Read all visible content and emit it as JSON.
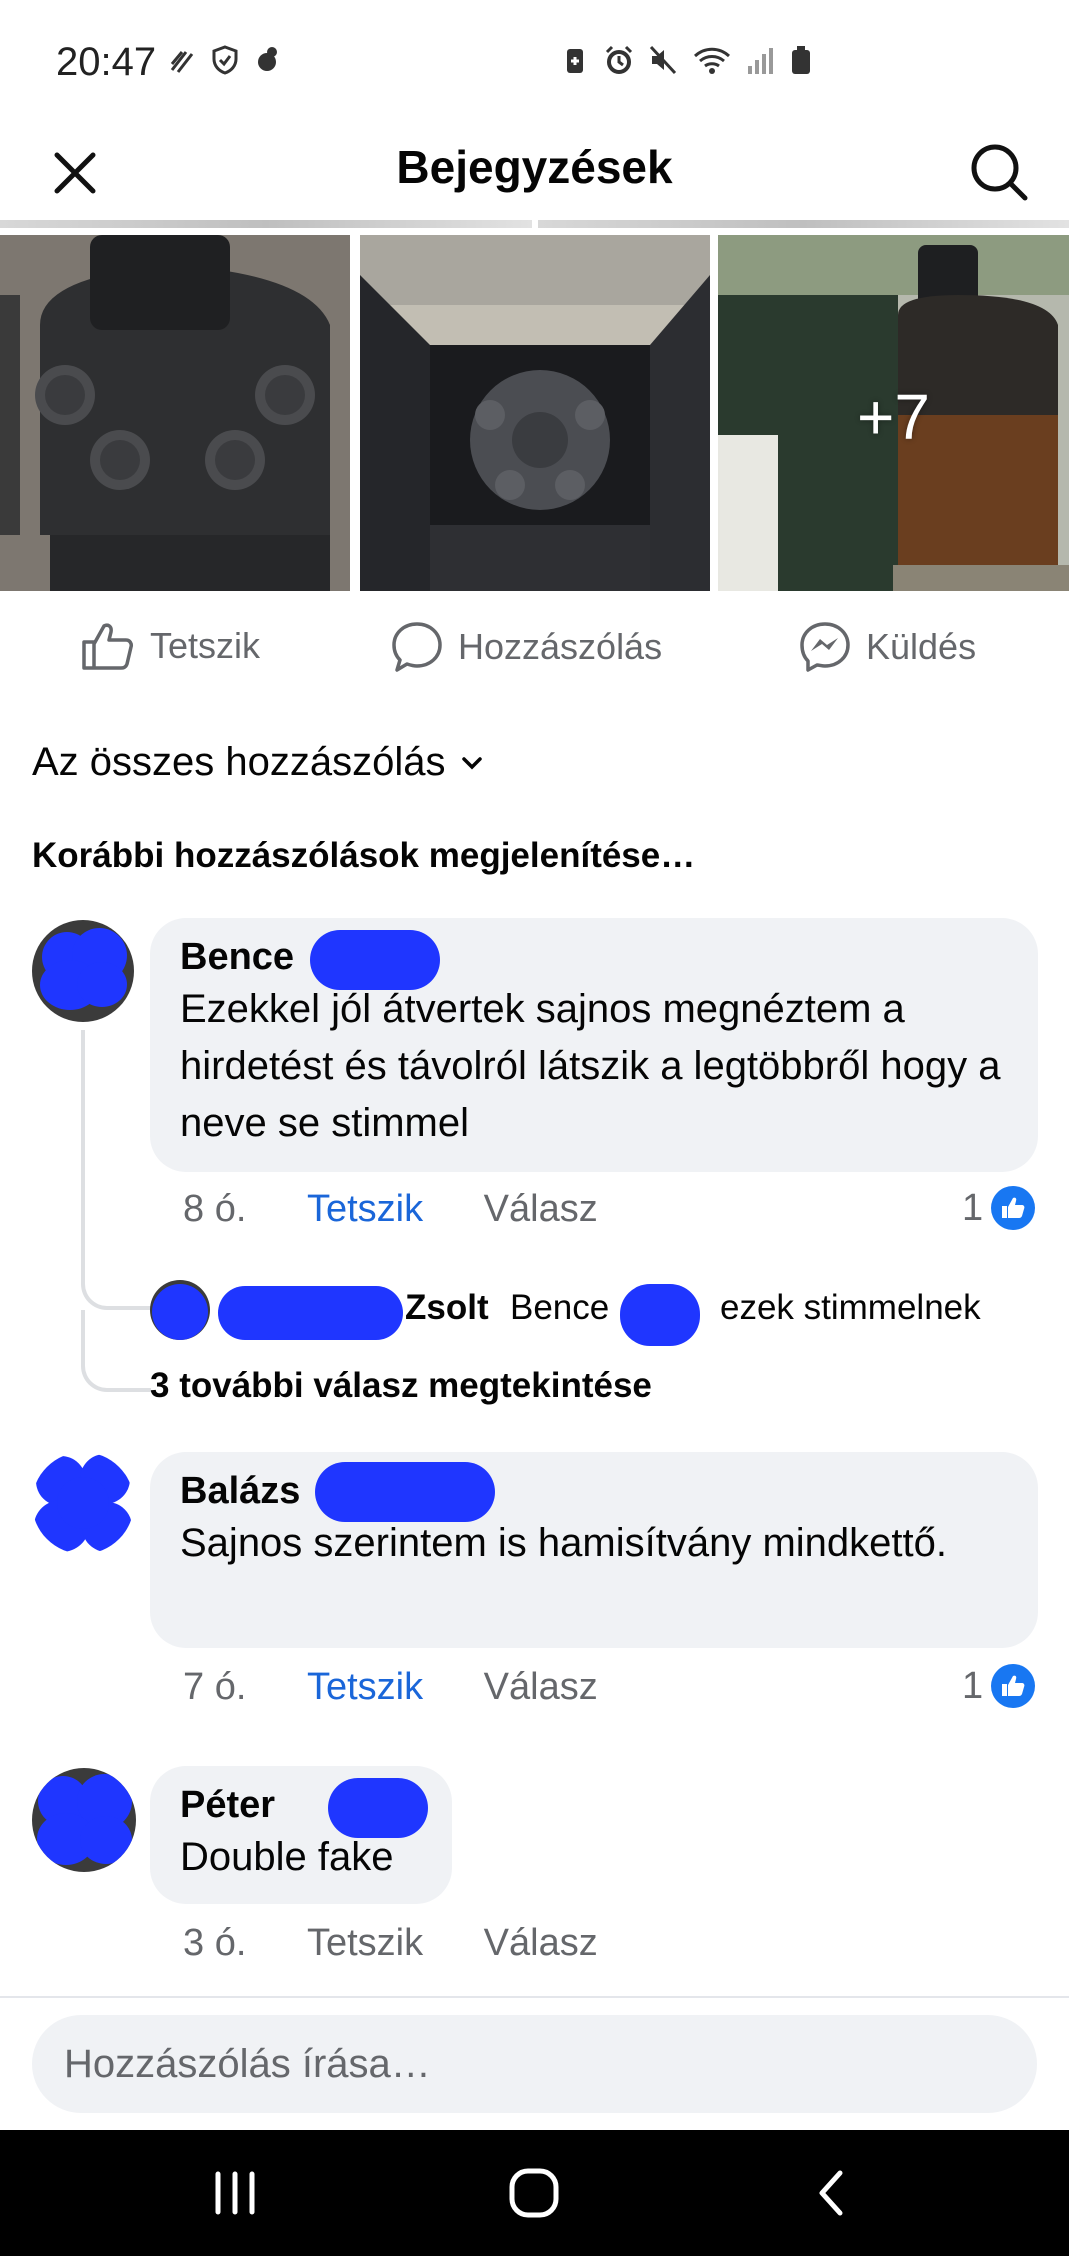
{
  "status_bar": {
    "time": "20:47",
    "left_icons": [
      "no-sim-stripes-icon",
      "shield-icon",
      "notification-icon"
    ],
    "right_icons": [
      "battery-saver-icon",
      "alarm-icon",
      "mute-icon",
      "wifi-icon",
      "signal-icon",
      "battery-icon"
    ]
  },
  "header": {
    "title": "Bejegyzések",
    "close_icon": "close-icon",
    "search_icon": "search-icon"
  },
  "photos": {
    "more_count": "+7"
  },
  "actions": {
    "like": "Tetszik",
    "comment": "Hozzászólás",
    "send": "Küldés"
  },
  "filter": {
    "label": "Az összes hozzászólás"
  },
  "previous_comments": "Korábbi hozzászólások megjelenítése…",
  "comments": [
    {
      "author": "Bence",
      "text": "Ezekkel jól átvertek sajnos megnéztem a hirdetést és távolról látszik a legtöbbről hogy a neve se stimmel",
      "time": "8 ó.",
      "like": "Tetszik",
      "reply": "Válasz",
      "reactions": "1"
    },
    {
      "author": "Balázs",
      "text": "Sajnos szerintem is hamisítvány mindkettő.",
      "time": "7 ó.",
      "like": "Tetszik",
      "reply": "Válasz",
      "reactions": "1"
    },
    {
      "author": "Péter",
      "text": "Double fake",
      "time": "3 ó.",
      "like": "Tetszik",
      "reply": "Válasz"
    }
  ],
  "reply_preview": {
    "author": "Zsolt",
    "mention": "Bence",
    "text": "ezek stimmelnek"
  },
  "more_replies": "3 további válasz megtekintése",
  "composer": {
    "placeholder": "Hozzászólás írása…"
  },
  "colors": {
    "accent": "#1a66d9",
    "like_badge": "#1877f2",
    "bubble": "#f0f2f5",
    "secondary_text": "#65676b"
  }
}
